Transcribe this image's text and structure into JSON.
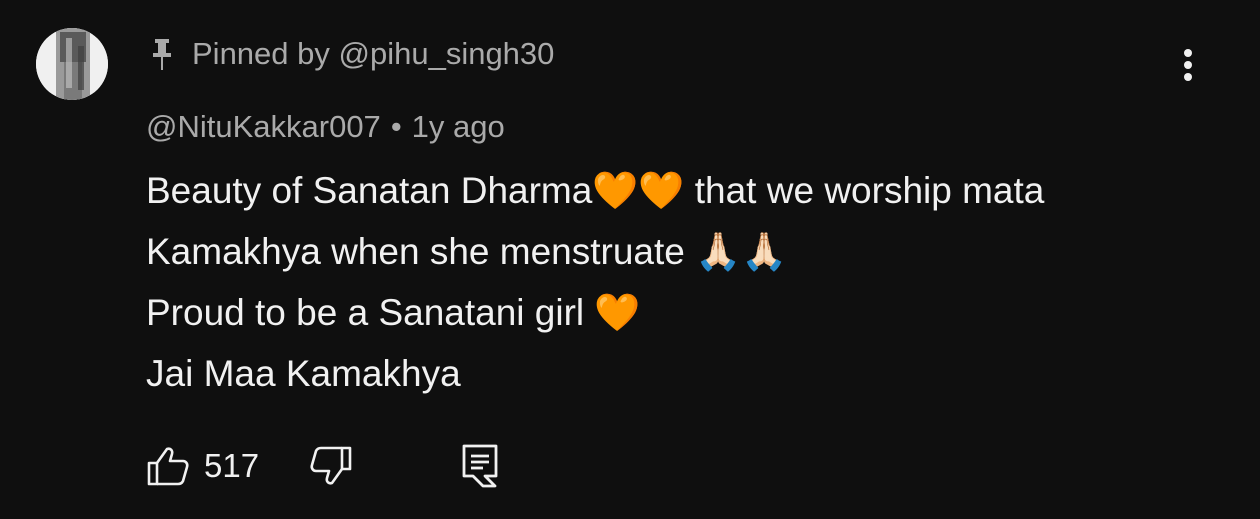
{
  "comment": {
    "pinned_text": "Pinned by @pihu_singh30",
    "author": "@NituKakkar007",
    "separator": "•",
    "time": "1y ago",
    "lines": [
      "Beauty of Sanatan Dharma🧡🧡 that we worship mata",
      "Kamakhya when she menstruate 🙏🏻🙏🏻",
      "Proud to be a Sanatani girl 🧡",
      "Jai Maa Kamakhya"
    ],
    "like_count": "517"
  },
  "colors": {
    "background": "#0f0f0f",
    "primary_text": "#f1f1f1",
    "secondary_text": "#aaaaaa",
    "heart": "#ff8c1a"
  },
  "icons": {
    "pin": "pin-icon",
    "more": "more-vertical-icon",
    "like": "thumbs-up-icon",
    "dislike": "thumbs-down-icon",
    "reply": "reply-icon"
  }
}
